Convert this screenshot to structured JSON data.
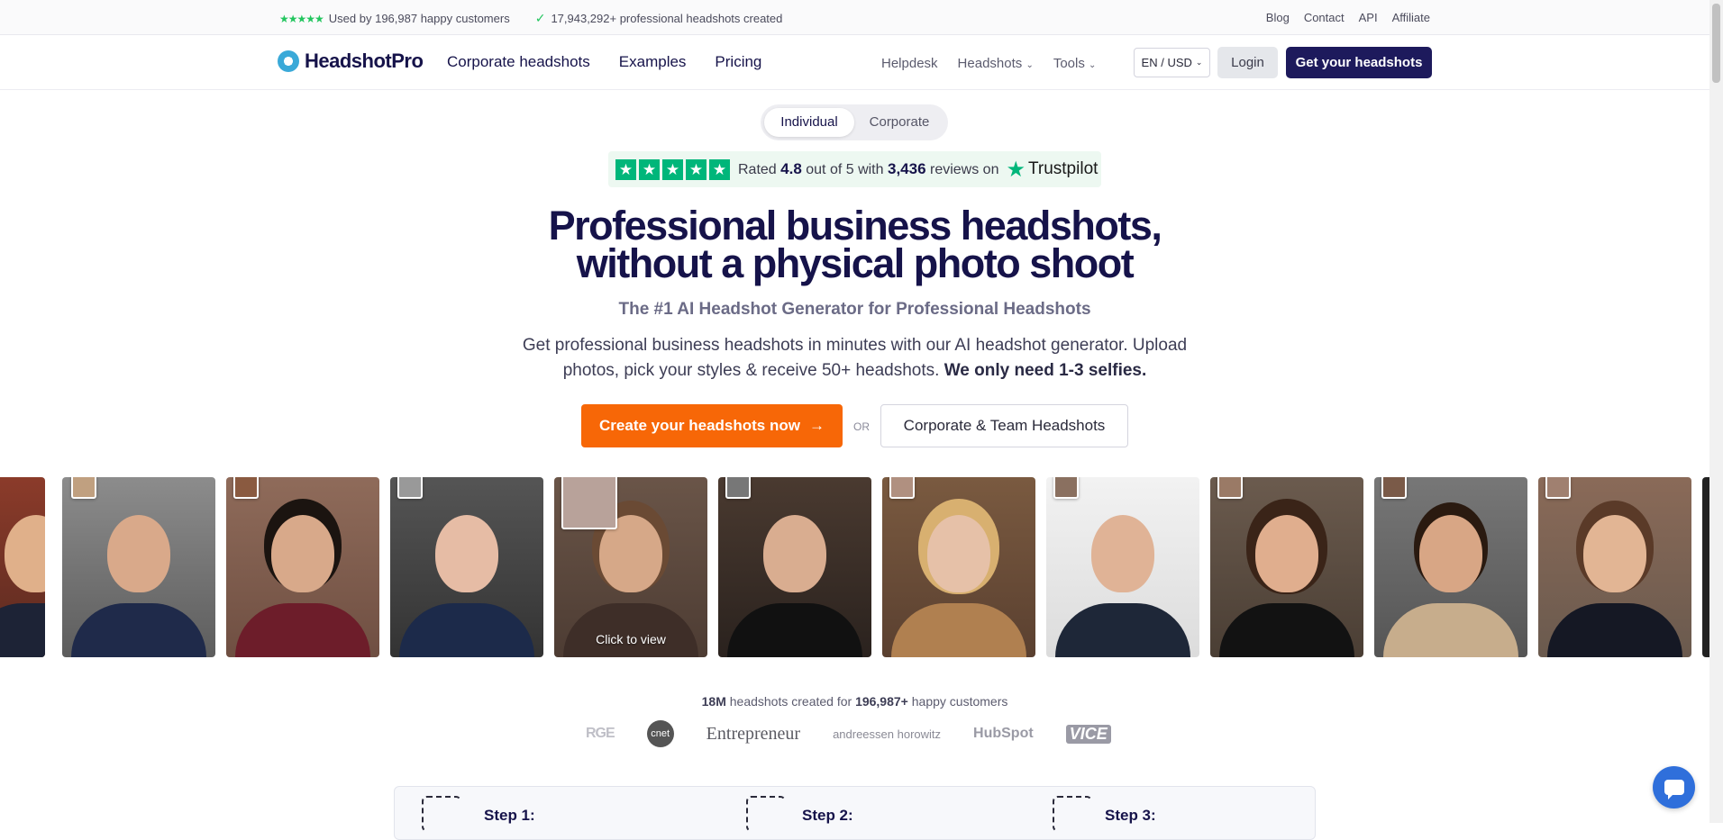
{
  "topbar": {
    "stars": "★★★★★",
    "customers_text": "Used by 196,987 happy customers",
    "headshots_text": "17,943,292+ professional headshots created",
    "links": [
      "Blog",
      "Contact",
      "API",
      "Affiliate"
    ]
  },
  "nav": {
    "brand": "HeadshotPro",
    "main_links": [
      "Corporate headshots",
      "Examples",
      "Pricing"
    ],
    "helpdesk": "Helpdesk",
    "headshots": "Headshots",
    "tools": "Tools",
    "lang": "EN / USD",
    "login": "Login",
    "cta": "Get your headshots"
  },
  "toggle": {
    "individual": "Individual",
    "corporate": "Corporate"
  },
  "trustpilot": {
    "rated": "Rated",
    "rating": "4.8",
    "out_of": "out of 5 with",
    "reviews": "3,436",
    "reviews_on": "reviews on",
    "brand": "Trustpilot"
  },
  "hero": {
    "title_line1": "Professional business headshots,",
    "title_line2": "without a physical photo shoot",
    "subtitle": "The #1 AI Headshot Generator for Professional Headshots",
    "desc_plain": "Get professional business headshots in minutes with our AI headshot generator. Upload photos, pick your styles & receive 50+ headshots.",
    "desc_bold": "We only need 1-3 selfies.",
    "cta_primary": "Create your headshots now",
    "or": "OR",
    "cta_secondary": "Corporate & Team Headshots"
  },
  "gallery": {
    "click_to_view": "Click to view"
  },
  "stats": {
    "count": "18M",
    "middle": "headshots created for",
    "customers": "196,987+",
    "tail": "happy customers"
  },
  "press_logos": [
    "RGE",
    "cnet",
    "Entrepreneur",
    "andreessen horowitz",
    "HubSpot",
    "VICE"
  ],
  "steps": [
    "Step 1:",
    "Step 2:",
    "Step 3:"
  ],
  "colors": {
    "brand_navy": "#1d1a5c",
    "cta_orange": "#f76707",
    "trustpilot_green": "#00b67a"
  }
}
